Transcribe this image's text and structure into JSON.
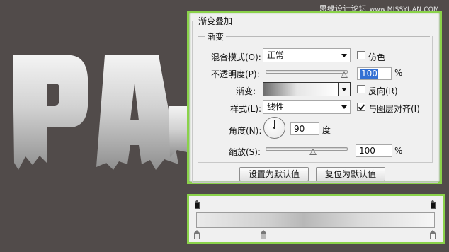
{
  "watermark": {
    "site_cn": "思缘设计论坛",
    "site_url": "www.MISSYUAN.COM"
  },
  "artwork": {
    "letters": "PA"
  },
  "dialog": {
    "section_title": "渐变叠加",
    "group_title": "渐变",
    "blend_mode_label": "混合模式(O):",
    "blend_mode_value": "正常",
    "dither_label": "仿色",
    "dither_checked": false,
    "opacity_label": "不透明度(P):",
    "opacity_value": "100",
    "opacity_unit": "%",
    "gradient_label": "渐变:",
    "reverse_label": "反向(R)",
    "reverse_checked": false,
    "style_label": "样式(L):",
    "style_value": "线性",
    "align_label": "与图层对齐(I)",
    "align_checked": true,
    "angle_label": "角度(N):",
    "angle_value": "90",
    "angle_unit": "度",
    "scale_label": "缩放(S):",
    "scale_value": "100",
    "scale_unit": "%",
    "reset_default_label": "设置为默认值",
    "restore_default_label": "复位为默认值"
  },
  "colors": {
    "accent_border": "#8ad24a",
    "background": "#514b4a",
    "selection": "#3470d3"
  },
  "gradient_editor": {
    "opacity_stops": 2,
    "color_stops": 3
  }
}
